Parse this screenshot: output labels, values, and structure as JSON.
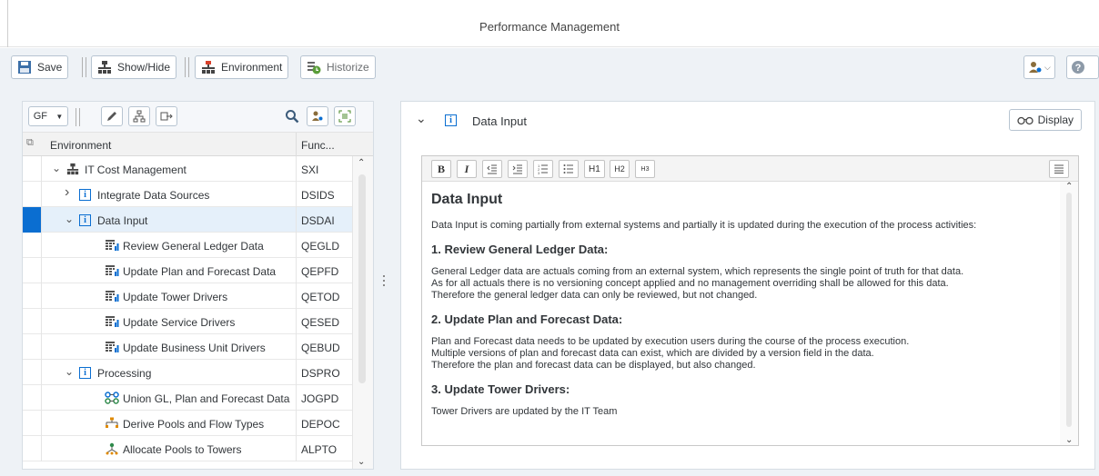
{
  "app": {
    "title": "Performance Management"
  },
  "toolbar": {
    "save": "Save",
    "show_hide": "Show/Hide",
    "environment": "Environment",
    "historize": "Historize"
  },
  "left_toolbar": {
    "view_select": "GF"
  },
  "tree": {
    "col_environment": "Environment",
    "col_function": "Func...",
    "rows": [
      {
        "label": "IT Cost Management",
        "func": "SXI",
        "icon": "hierarchy-icon",
        "level": 0,
        "expanded": true
      },
      {
        "label": "Integrate Data Sources",
        "func": "DSIDS",
        "icon": "info-icon",
        "level": 1,
        "expanded": false
      },
      {
        "label": "Data Input",
        "func": "DSDAI",
        "icon": "info-icon",
        "level": 1,
        "expanded": true,
        "selected": true
      },
      {
        "label": "Review General Ledger Data",
        "func": "QEGLD",
        "icon": "query-table-icon",
        "level": 2
      },
      {
        "label": "Update Plan and Forecast Data",
        "func": "QEPFD",
        "icon": "query-table-icon",
        "level": 2
      },
      {
        "label": "Update Tower Drivers",
        "func": "QETOD",
        "icon": "query-table-icon",
        "level": 2
      },
      {
        "label": "Update Service Drivers",
        "func": "QESED",
        "icon": "query-table-icon",
        "level": 2
      },
      {
        "label": "Update Business Unit Drivers",
        "func": "QEBUD",
        "icon": "query-table-icon",
        "level": 2
      },
      {
        "label": "Processing",
        "func": "DSPRO",
        "icon": "info-icon",
        "level": 1,
        "expanded": true
      },
      {
        "label": "Union GL, Plan and Forecast Data",
        "func": "JOGPD",
        "icon": "join-icon",
        "level": 2
      },
      {
        "label": "Derive Pools and Flow Types",
        "func": "DEPOC",
        "icon": "derive-icon",
        "level": 2
      },
      {
        "label": "Allocate Pools to Towers",
        "func": "ALPTO",
        "icon": "allocate-icon",
        "level": 2
      }
    ]
  },
  "detail": {
    "title": "Data Input",
    "display_label": "Display",
    "editor_buttons": [
      "B",
      "I",
      "H1",
      "H2",
      "H3"
    ],
    "content": {
      "heading": "Data Input",
      "intro": "Data Input is coming partially from external systems and partially it is updated during the execution of the process activities:",
      "sections": [
        {
          "title": "1. Review General Ledger Data:",
          "lines": [
            "General Ledger data are actuals coming from an external system, which represents the single point of truth for that data.",
            "As for all actuals there is no versioning concept applied and no management overriding shall be allowed for this data.",
            "Therefore the general ledger data can only be reviewed, but not changed."
          ]
        },
        {
          "title": "2. Update Plan and Forecast Data:",
          "lines": [
            "Plan and Forecast data needs to be updated by execution users during the course of the process execution.",
            "Multiple versions of plan and forecast data can exist, which are divided by a version field in the data.",
            "Therefore the plan and forecast data can be displayed, but also changed."
          ]
        },
        {
          "title": "3. Update Tower Drivers:",
          "lines": [
            "Tower Drivers are updated by the IT Team"
          ]
        }
      ]
    }
  },
  "colors": {
    "accent": "#0a6ed1",
    "background": "#eef2f6",
    "selected_row": "#e5f0fa"
  }
}
